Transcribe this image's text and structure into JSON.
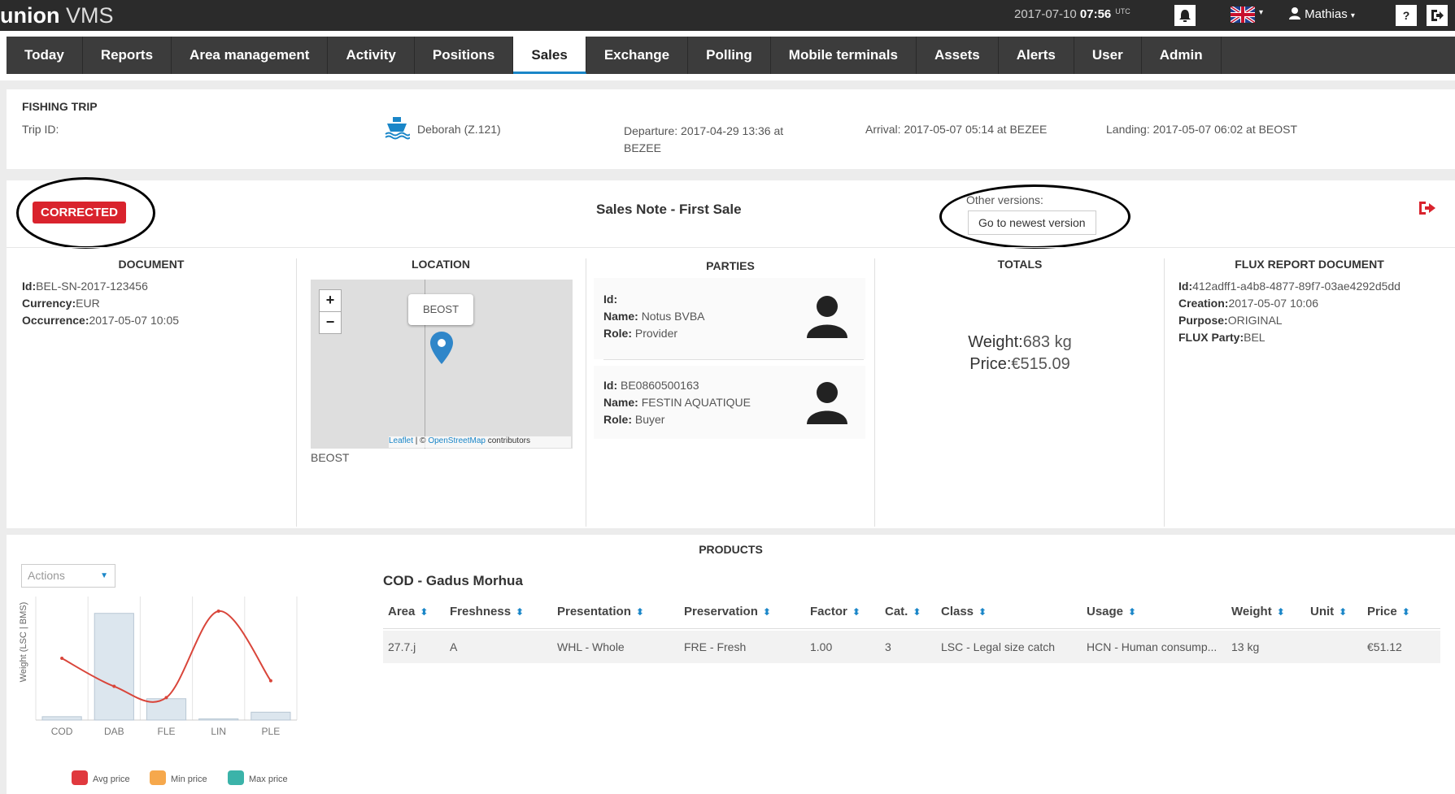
{
  "app": {
    "logo_bold": "union",
    "logo_light": "VMS"
  },
  "topbar": {
    "date": "2017-07-10",
    "time": "07:56",
    "tz": "UTC",
    "user": "Mathias",
    "help": "?"
  },
  "nav": [
    "Today",
    "Reports",
    "Area management",
    "Activity",
    "Positions",
    "Sales",
    "Exchange",
    "Polling",
    "Mobile terminals",
    "Assets",
    "Alerts",
    "User",
    "Admin"
  ],
  "nav_active": "Sales",
  "trip": {
    "title": "FISHING TRIP",
    "trip_id_label": "Trip ID:",
    "vessel": "Deborah (Z.121)",
    "departure": "Departure: 2017-04-29 13:36 at BEZEE",
    "arrival": "Arrival: 2017-05-07 05:14 at BEZEE",
    "landing": "Landing: 2017-05-07 06:02 at BEOST"
  },
  "note": {
    "status": "CORRECTED",
    "title": "Sales Note - First Sale",
    "other_versions_label": "Other versions:",
    "newest_button": "Go to newest version",
    "status_color": "#d9232d"
  },
  "document": {
    "heading": "DOCUMENT",
    "id_label": "Id:",
    "id": "BEL-SN-2017-123456",
    "currency_label": "Currency:",
    "currency": "EUR",
    "occurrence_label": "Occurrence:",
    "occurrence": "2017-05-07 10:05"
  },
  "location": {
    "heading": "LOCATION",
    "popup": "BEOST",
    "attribution_leaflet": "Leaflet",
    "attribution_osm": "OpenStreetMap",
    "attribution_rest": "contributors",
    "caption": "BEOST"
  },
  "parties": {
    "heading": "PARTIES",
    "id_label": "Id:",
    "name_label": "Name:",
    "role_label": "Role:",
    "list": [
      {
        "id": "",
        "name": "Notus BVBA",
        "role": "Provider"
      },
      {
        "id": "BE0860500163",
        "name": "FESTIN AQUATIQUE",
        "role": "Buyer"
      }
    ]
  },
  "totals": {
    "heading": "TOTALS",
    "weight_label": "Weight:",
    "weight": "683 kg",
    "price_label": "Price:",
    "price": "€515.09"
  },
  "flux": {
    "heading": "FLUX REPORT DOCUMENT",
    "id_label": "Id:",
    "id": "412adff1-a4b8-4877-89f7-03ae4292d5dd",
    "creation_label": "Creation:",
    "creation": "2017-05-07 10:06",
    "purpose_label": "Purpose:",
    "purpose": "ORIGINAL",
    "party_label": "FLUX Party:",
    "party": "BEL"
  },
  "products": {
    "heading": "PRODUCTS",
    "actions": "Actions",
    "species": "COD - Gadus Morhua",
    "columns": [
      "Area",
      "Freshness",
      "Presentation",
      "Preservation",
      "Factor",
      "Cat.",
      "Class",
      "Usage",
      "Weight",
      "Unit",
      "Price"
    ],
    "rows": [
      [
        "27.7.j",
        "A",
        "WHL - Whole",
        "FRE - Fresh",
        "1.00",
        "3",
        "LSC - Legal size catch",
        "HCN - Human consump...",
        "13 kg",
        "",
        "€51.12"
      ]
    ]
  },
  "chart_data": {
    "type": "bar",
    "categories": [
      "COD",
      "DAB",
      "FLE",
      "LIN",
      "PLE"
    ],
    "ylabel": "Weight (LSC | BMS)",
    "series": [
      {
        "name": "Weight",
        "kind": "bar",
        "values": [
          3,
          95,
          19,
          1,
          7
        ],
        "color": "#dce6ee"
      },
      {
        "name": "Avg price",
        "kind": "line",
        "values": [
          55,
          30,
          20,
          97,
          35
        ],
        "color": "#d9453a"
      }
    ],
    "ylim": [
      0,
      110
    ],
    "legend": [
      {
        "label": "Avg price",
        "color": "#e0393e"
      },
      {
        "label": "Min price",
        "color": "#f6a84c"
      },
      {
        "label": "Max price",
        "color": "#3bb3a9"
      }
    ],
    "legend_position": "bottom"
  }
}
